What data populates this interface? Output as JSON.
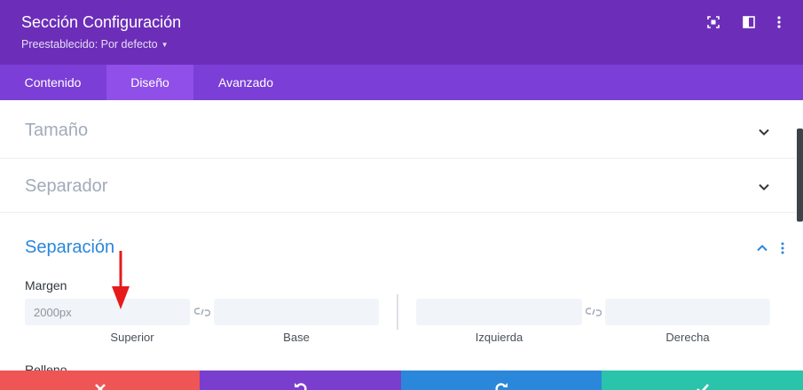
{
  "header": {
    "title": "Sección Configuración",
    "preset_label": "Preestablecido: Por defecto",
    "icons": [
      "fullscreen-icon",
      "sidebar-layout-icon",
      "more-vertical-icon"
    ],
    "bg_color": "#6c2eb9"
  },
  "tabs": [
    {
      "label": "Contenido",
      "active": false
    },
    {
      "label": "Diseño",
      "active": true
    },
    {
      "label": "Avanzado",
      "active": false
    }
  ],
  "sections": {
    "tamano": {
      "title": "Tamaño",
      "expanded": false
    },
    "separador": {
      "title": "Separador",
      "expanded": false
    },
    "separacion": {
      "title": "Separación",
      "expanded": true
    }
  },
  "spacing": {
    "margin_label": "Margen",
    "padding_label": "Relleno",
    "margin": {
      "top": {
        "label": "Superior",
        "value": "2000px"
      },
      "bottom": {
        "label": "Base",
        "value": ""
      },
      "left": {
        "label": "Izquierda",
        "value": ""
      },
      "right": {
        "label": "Derecha",
        "value": ""
      }
    }
  },
  "footer": {
    "buttons": [
      {
        "name": "discard",
        "icon": "close-icon",
        "color": "#ef5555"
      },
      {
        "name": "undo",
        "icon": "undo-icon",
        "color": "#7a3ecf"
      },
      {
        "name": "redo",
        "icon": "redo-icon",
        "color": "#2b87da"
      },
      {
        "name": "save",
        "icon": "check-icon",
        "color": "#29c4a9"
      }
    ]
  },
  "colors": {
    "accent_blue": "#2b87da",
    "tab_bar": "#7b3ed6",
    "annotation_arrow": "#e51b1b"
  }
}
